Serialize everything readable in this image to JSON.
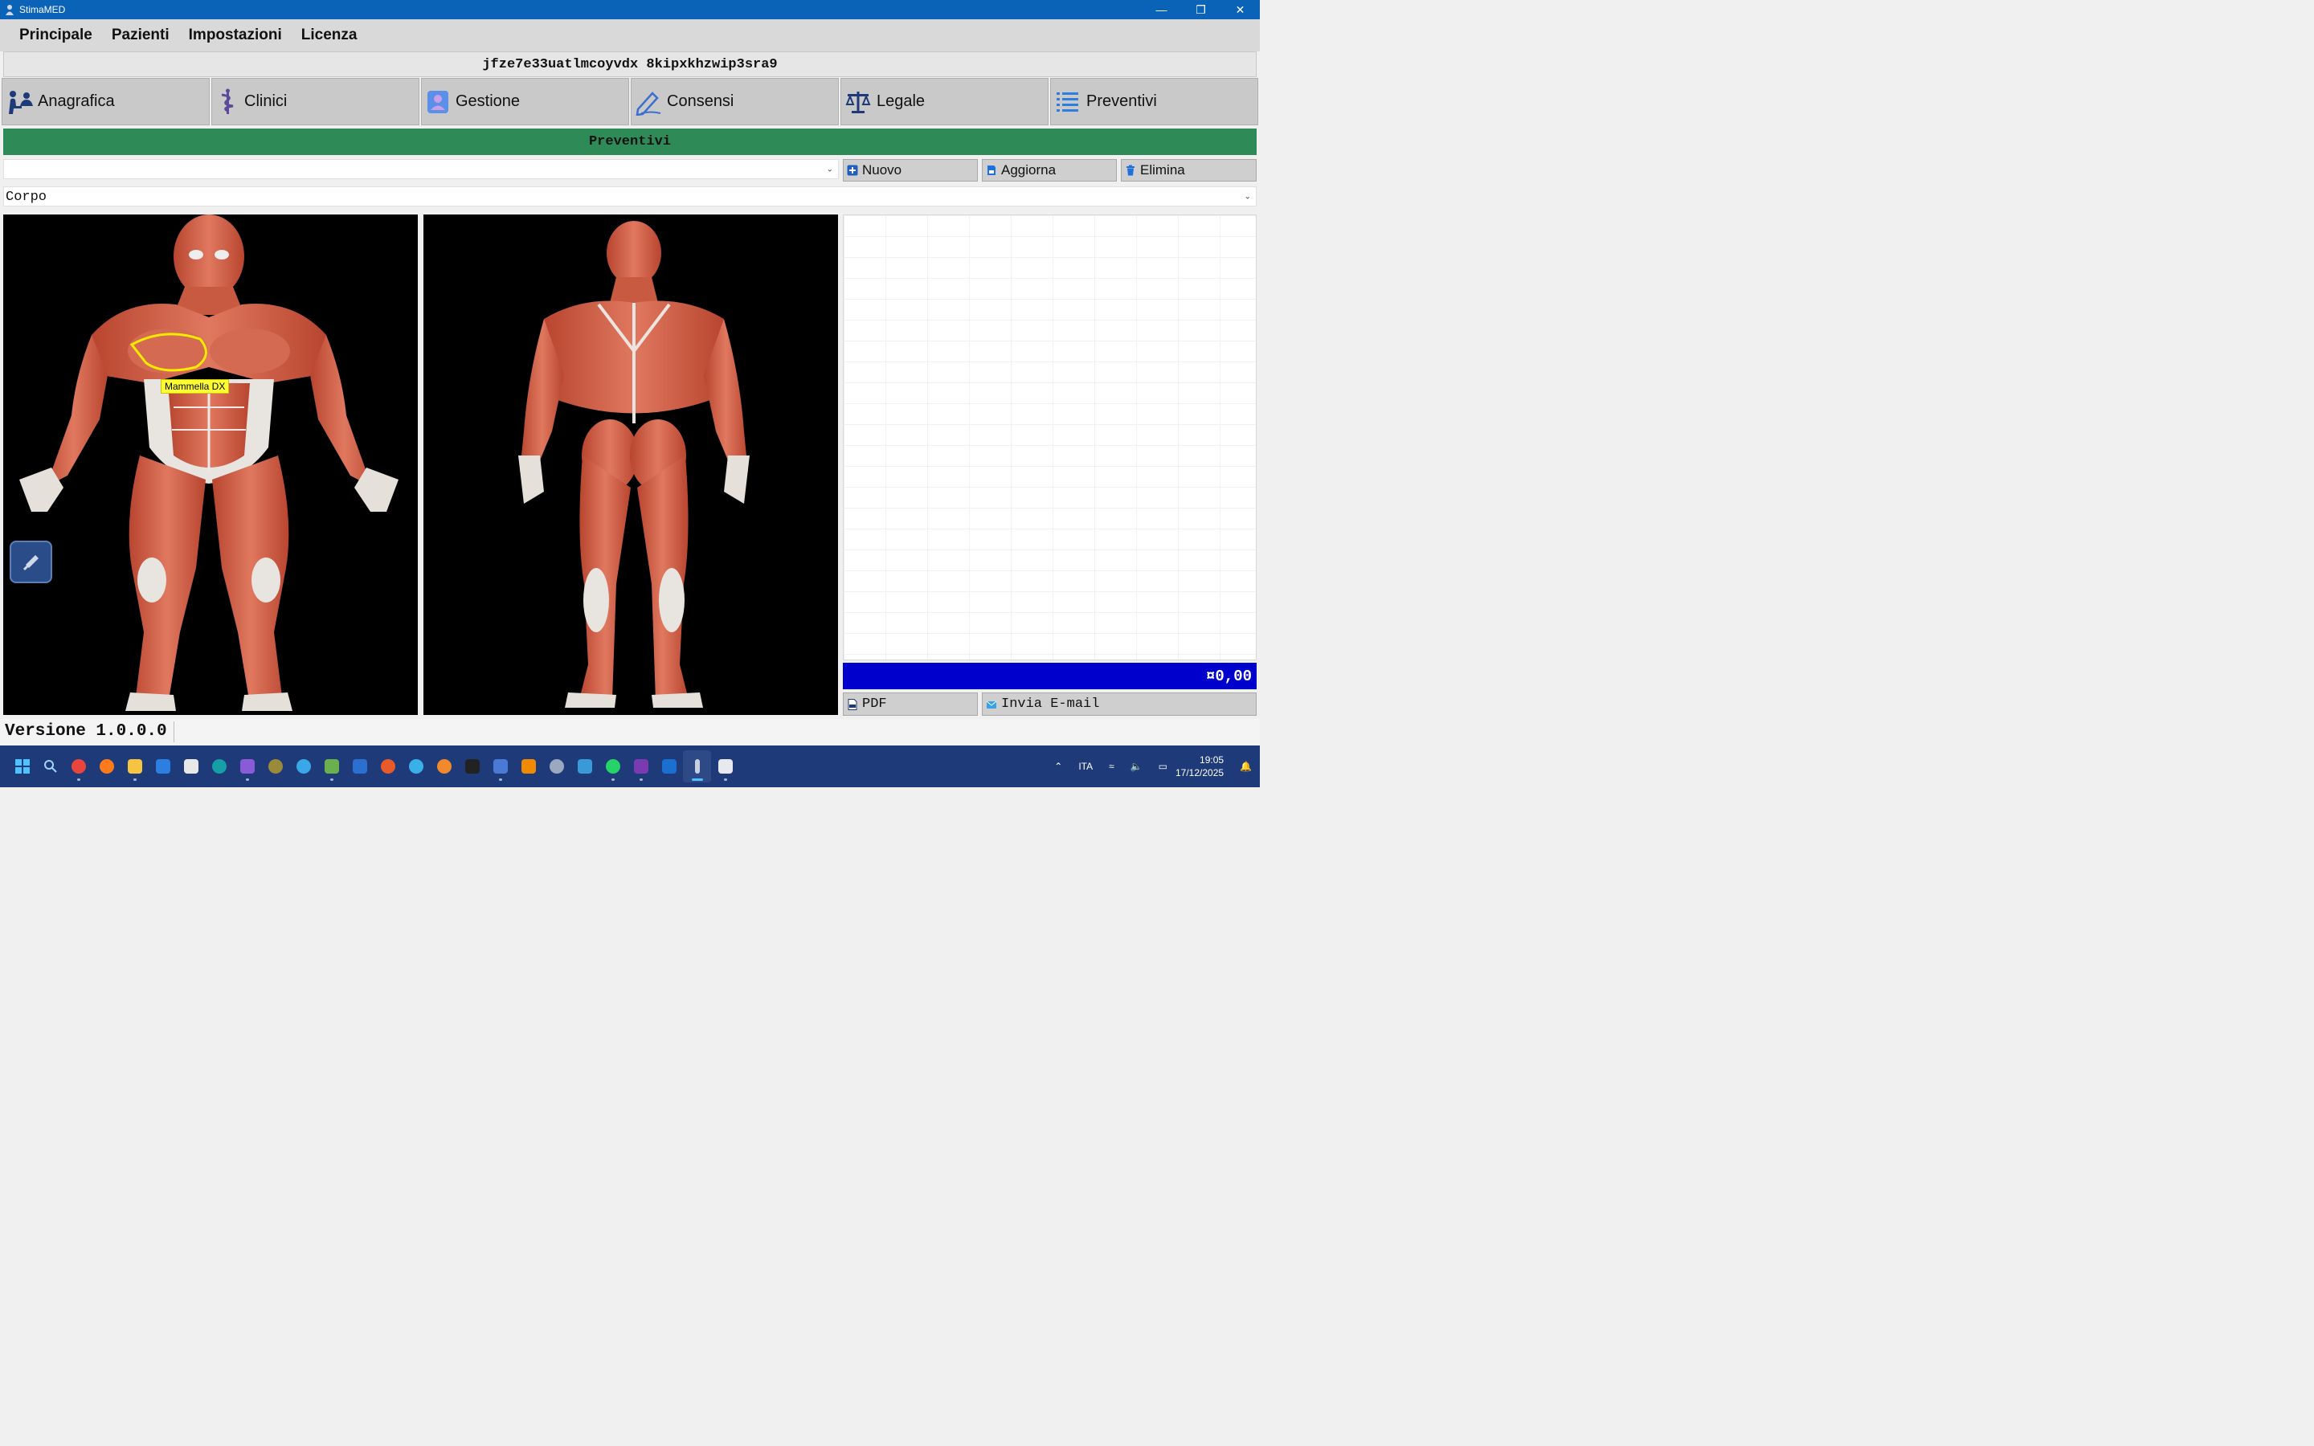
{
  "window": {
    "title": "StimaMED"
  },
  "menu": [
    "Principale",
    "Pazienti",
    "Impostazioni",
    "Licenza"
  ],
  "uid": "jfze7e33uatlmcoyvdx 8kipxkhzwip3sra9",
  "tabs": [
    {
      "label": "Anagrafica",
      "icon": "people-icon"
    },
    {
      "label": "Clinici",
      "icon": "caduceus-icon"
    },
    {
      "label": "Gestione",
      "icon": "user-badge-icon"
    },
    {
      "label": "Consensi",
      "icon": "pen-icon"
    },
    {
      "label": "Legale",
      "icon": "scales-icon"
    },
    {
      "label": "Preventivi",
      "icon": "list-icon"
    }
  ],
  "section": {
    "title": "Preventivi"
  },
  "preventivo_select": {
    "value": ""
  },
  "actions": {
    "nuovo": "Nuovo",
    "aggiorna": "Aggiorna",
    "elimina": "Elimina"
  },
  "body_area_select": {
    "value": "Corpo"
  },
  "front_view": {
    "hotspot_label": "Mammella DX"
  },
  "total": "¤0,00",
  "bottom_actions": {
    "pdf": "PDF",
    "email": "Invia E-mail"
  },
  "status": {
    "version": "Versione 1.0.0.0"
  },
  "taskbar": {
    "language": "ITA",
    "time": "19:05",
    "date": "17/12/2025"
  },
  "colors": {
    "title_bar": "#0a63b6",
    "section_header": "#2e8b57",
    "total_bar": "#0000cc",
    "taskbar": "#1f3a78"
  }
}
